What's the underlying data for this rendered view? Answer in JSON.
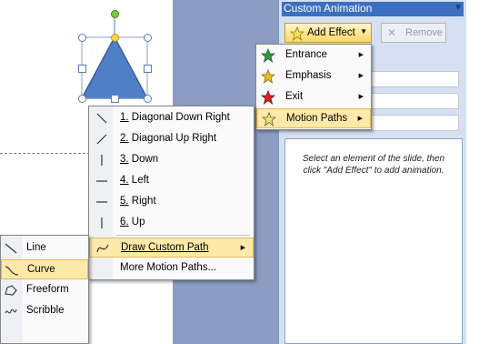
{
  "task_pane": {
    "title": "Custom Animation",
    "add_effect_label": "Add Effect",
    "remove_label": "Remove",
    "hint_line1": "Select an element of the slide, then",
    "hint_line2": "click \"Add Effect\" to add animation."
  },
  "add_effect_menu": [
    {
      "label": "Entrance",
      "icon": "entrance-star-icon",
      "color": "#2e9a3a"
    },
    {
      "label": "Emphasis",
      "icon": "emphasis-star-icon",
      "color": "#e8c21a"
    },
    {
      "label": "Exit",
      "icon": "exit-star-icon",
      "color": "#d42424"
    },
    {
      "label": "Motion Paths",
      "icon": "motion-path-star-icon",
      "color": "#f5e66a"
    }
  ],
  "motion_paths_menu": [
    {
      "num": "1.",
      "label": "Diagonal Down Right",
      "icon": "diagonal-down-right-icon"
    },
    {
      "num": "2.",
      "label": "Diagonal Up Right",
      "icon": "diagonal-up-right-icon"
    },
    {
      "num": "3.",
      "label": "Down",
      "icon": "down-line-icon"
    },
    {
      "num": "4.",
      "label": "Left",
      "icon": "left-line-icon"
    },
    {
      "num": "5.",
      "label": "Right",
      "icon": "right-line-icon"
    },
    {
      "num": "6.",
      "label": "Up",
      "icon": "up-line-icon"
    },
    {
      "label": "Draw Custom Path",
      "icon": "custom-path-icon"
    },
    {
      "label": "More Motion Paths..."
    }
  ],
  "custom_path_menu": [
    {
      "label": "Line",
      "icon": "line-icon"
    },
    {
      "label": "Curve",
      "icon": "curve-icon"
    },
    {
      "label": "Freeform",
      "icon": "freeform-icon"
    },
    {
      "label": "Scribble",
      "icon": "scribble-icon"
    }
  ],
  "colors": {
    "highlight": "#ffe9a8",
    "pane_bg": "#d5e1f2",
    "editor_bg": "#8b9dc3",
    "triangle": "#4f7fc6"
  }
}
